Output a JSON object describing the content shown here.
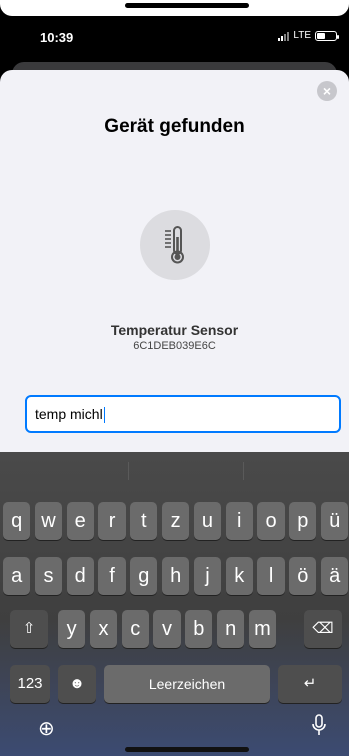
{
  "status": {
    "time": "10:39",
    "network": "LTE",
    "battery_level": 0.45
  },
  "sheet": {
    "title": "Gerät gefunden",
    "close_icon": "close-icon",
    "device": {
      "icon": "thermometer-icon",
      "name": "Temperatur Sensor",
      "id": "6C1DEB039E6C"
    },
    "name_field": {
      "value": "temp michl"
    }
  },
  "keyboard": {
    "row1": [
      "q",
      "w",
      "e",
      "r",
      "t",
      "z",
      "u",
      "i",
      "o",
      "p",
      "ü"
    ],
    "row2": [
      "a",
      "s",
      "d",
      "f",
      "g",
      "h",
      "j",
      "k",
      "l",
      "ö",
      "ä"
    ],
    "row3": [
      "y",
      "x",
      "c",
      "v",
      "b",
      "n",
      "m"
    ],
    "numbers_label": "123",
    "space_label": "Leerzeichen",
    "icons": [
      "shift-icon",
      "backspace-icon",
      "emoji-icon",
      "return-icon",
      "globe-icon",
      "microphone-icon"
    ]
  }
}
